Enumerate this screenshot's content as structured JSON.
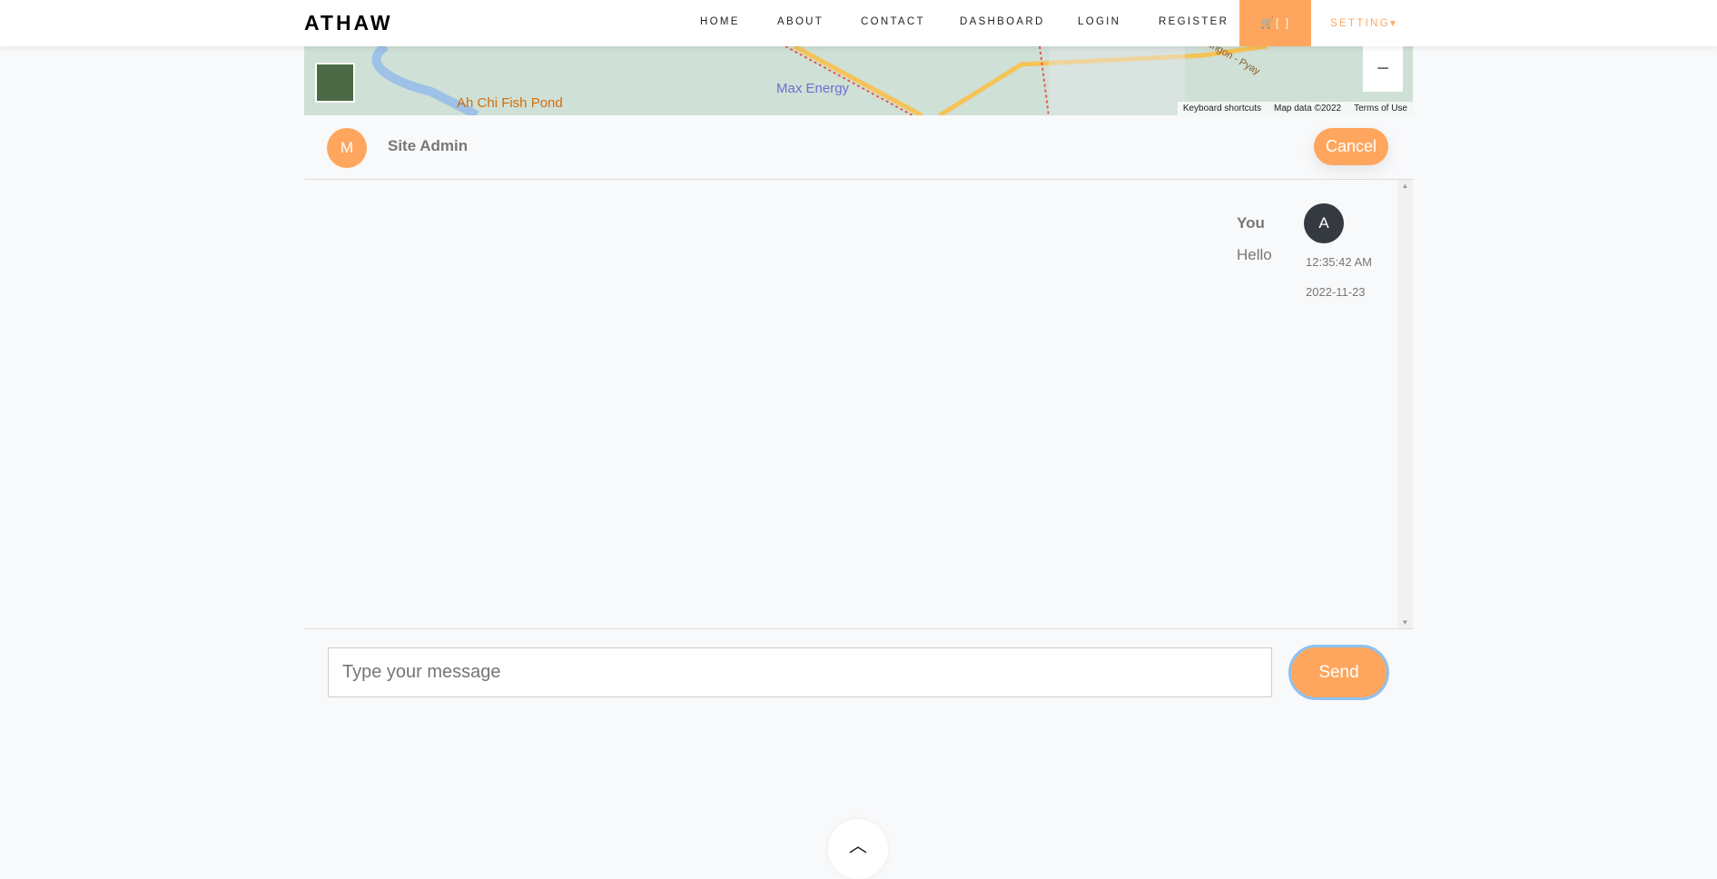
{
  "brand": "ATHAW",
  "nav": {
    "items": [
      "HOME",
      "ABOUT",
      "CONTACT",
      "DASHBOARD",
      "LOGIN",
      "REGISTER"
    ],
    "cart": "[ ]",
    "setting": "SETTING"
  },
  "map": {
    "labels": [
      "Ah Chi Fish Pond",
      "Max Energy",
      "Yangon - Pyay"
    ],
    "keyboard": "Keyboard shortcuts",
    "mapdata": "Map data ©2022",
    "terms": "Terms of Use"
  },
  "chat_header": {
    "avatar_letter": "M",
    "name": "Site Admin",
    "cancel": "Cancel"
  },
  "messages": [
    {
      "sender": "You",
      "avatar_letter": "A",
      "text": "Hello",
      "time": "12:35:42 AM",
      "date": "2022-11-23"
    }
  ],
  "composer": {
    "placeholder": "Type your message",
    "send": "Send"
  },
  "colors": {
    "accent": "#ffa65e",
    "dark": "#343a40"
  }
}
